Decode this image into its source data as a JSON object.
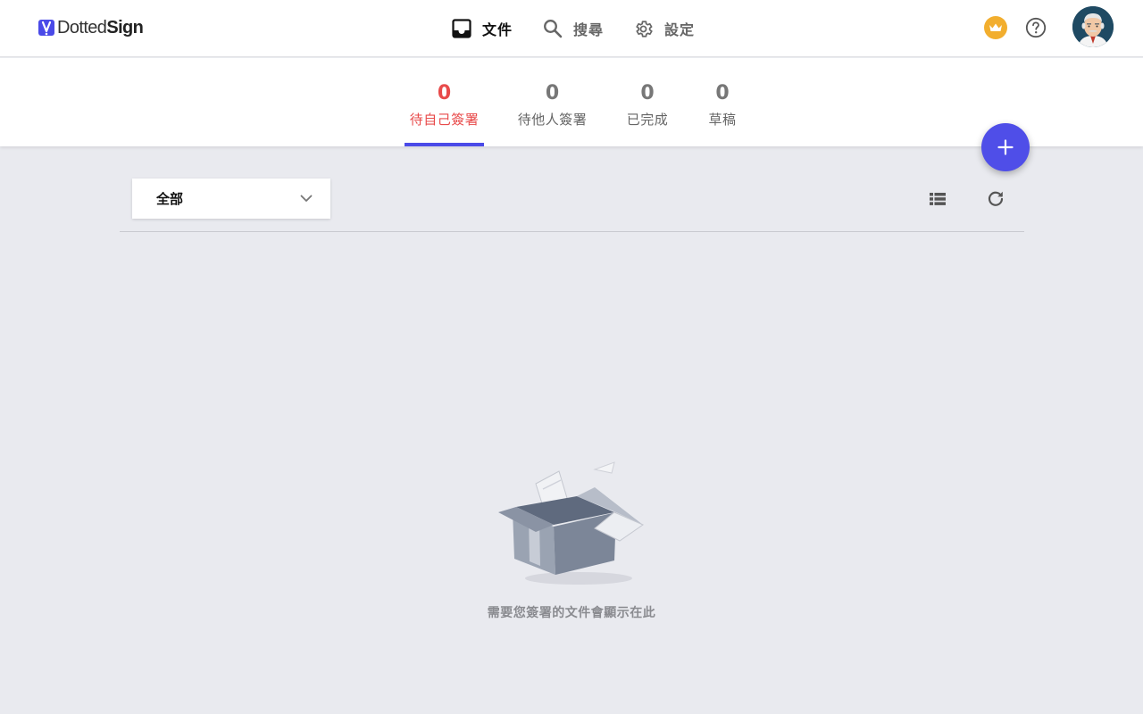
{
  "app": {
    "brand_light": "Dotted",
    "brand_bold": "Sign"
  },
  "nav": {
    "items": [
      {
        "label": "文件",
        "icon": "inbox-icon",
        "active": true
      },
      {
        "label": "搜尋",
        "icon": "search-icon",
        "active": false
      },
      {
        "label": "設定",
        "icon": "gear-icon",
        "active": false
      }
    ]
  },
  "header_actions": {
    "premium_icon": "crown-icon",
    "help_icon": "help-circle-icon",
    "avatar_icon": "user-avatar"
  },
  "tabs": [
    {
      "count": "0",
      "label": "待自己簽署",
      "active": true
    },
    {
      "count": "0",
      "label": "待他人簽署",
      "active": false
    },
    {
      "count": "0",
      "label": "已完成",
      "active": false
    },
    {
      "count": "0",
      "label": "草稿",
      "active": false
    }
  ],
  "toolbar": {
    "filter_value": "全部",
    "list_view_icon": "list-view-icon",
    "refresh_icon": "refresh-icon"
  },
  "fab": {
    "icon": "plus-icon"
  },
  "empty_state": {
    "message": "需要您簽署的文件會顯示在此"
  },
  "colors": {
    "accent": "#4f4ee8",
    "active_tab_text": "#e84b4b",
    "premium": "#f2ae2e",
    "background": "#e9eaef"
  }
}
